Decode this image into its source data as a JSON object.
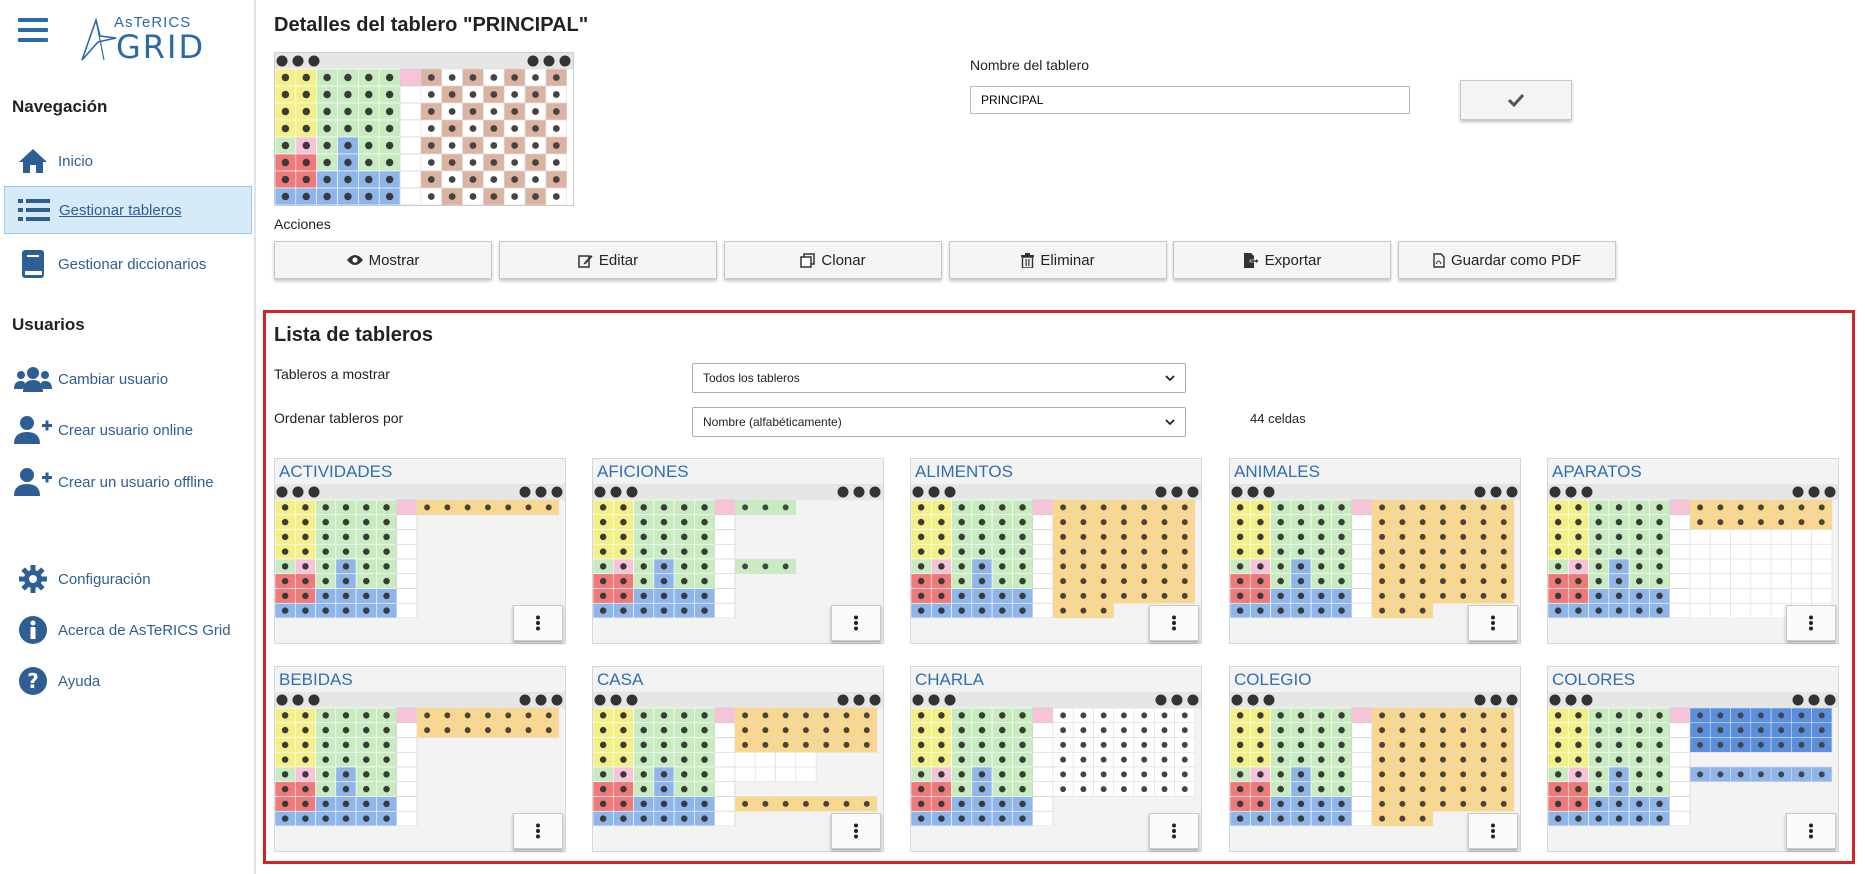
{
  "sidebar": {
    "logo_top": "AsTeRICS",
    "logo_bottom": "GRID",
    "nav_heading": "Navegación",
    "nav_items": [
      {
        "label": "Inicio",
        "icon": "home-icon"
      },
      {
        "label": "Gestionar tableros",
        "icon": "list-icon",
        "active": true
      },
      {
        "label": "Gestionar diccionarios",
        "icon": "book-icon"
      }
    ],
    "users_heading": "Usuarios",
    "user_items": [
      {
        "label": "Cambiar usuario",
        "icon": "users-icon"
      },
      {
        "label": "Crear usuario online",
        "icon": "user-plus-icon"
      },
      {
        "label": "Crear un usuario offline",
        "icon": "user-plus-icon"
      }
    ],
    "bottom_items": [
      {
        "label": "Configuración",
        "icon": "gear-icon"
      },
      {
        "label": "Acerca de AsTeRICS Grid",
        "icon": "info-icon"
      },
      {
        "label": "Ayuda",
        "icon": "question-icon"
      }
    ]
  },
  "details": {
    "title": "Detalles del tablero \"PRINCIPAL\"",
    "name_label": "Nombre del tablero",
    "name_value": "PRINCIPAL",
    "actions_label": "Acciones",
    "actions": [
      {
        "label": "Mostrar",
        "icon": "eye-icon"
      },
      {
        "label": "Editar",
        "icon": "edit-icon"
      },
      {
        "label": "Clonar",
        "icon": "clone-icon"
      },
      {
        "label": "Eliminar",
        "icon": "trash-icon"
      },
      {
        "label": "Exportar",
        "icon": "export-icon"
      },
      {
        "label": "Guardar como PDF",
        "icon": "pdf-icon"
      }
    ]
  },
  "list": {
    "title": "Lista de tableros",
    "show_label": "Tableros a mostrar",
    "show_value": "Todos los tableros",
    "sort_label": "Ordenar tableros por",
    "sort_value": "Nombre (alfabéticamente)",
    "cell_count": "44 celdas",
    "boards": [
      {
        "name": "ACTIVIDADES"
      },
      {
        "name": "AFICIONES"
      },
      {
        "name": "ALIMENTOS"
      },
      {
        "name": "ANIMALES"
      },
      {
        "name": "APARATOS"
      },
      {
        "name": "BEBIDAS"
      },
      {
        "name": "CASA"
      },
      {
        "name": "CHARLA"
      },
      {
        "name": "COLEGIO"
      },
      {
        "name": "COLORES"
      }
    ]
  },
  "colors": {
    "accent": "#2e6fb0",
    "highlight_border": "#d2232a",
    "active_nav_bg": "#d6eaf7",
    "cell_green": "#c8ecc0",
    "cell_yellow": "#f3f08a",
    "cell_pink": "#f7c3d8",
    "cell_red": "#f07a7a",
    "cell_blue": "#8fb6ea",
    "cell_orange": "#fbd78c",
    "cell_brown": "#dcb3a0",
    "cell_blue_dark": "#5a8fde"
  }
}
